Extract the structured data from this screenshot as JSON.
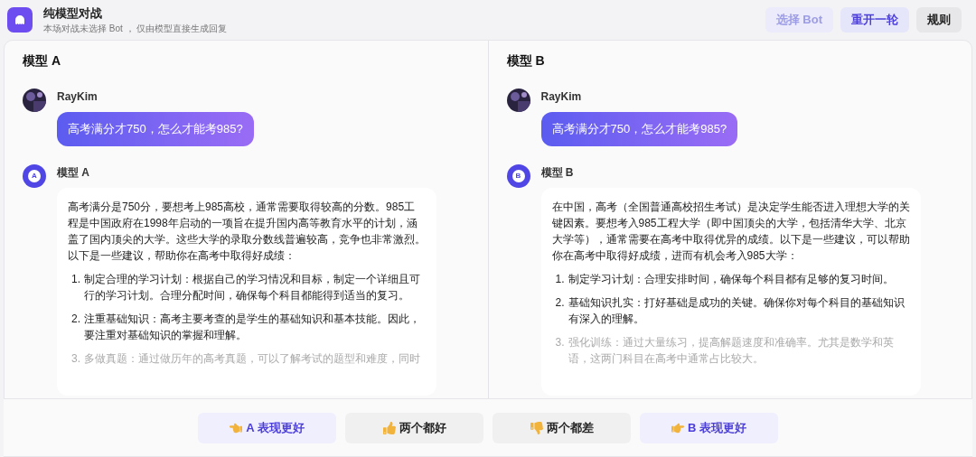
{
  "header": {
    "title": "纯模型对战",
    "subtitle": "本场对战未选择 Bot ， 仅由模型直接生成回复",
    "buttons": [
      {
        "label": "选择 Bot",
        "kind": "primary",
        "disabled": true
      },
      {
        "label": "重开一轮",
        "kind": "primary",
        "disabled": false
      },
      {
        "label": "规则",
        "kind": "neutral",
        "disabled": false
      }
    ]
  },
  "panels": [
    {
      "title": "模型 A",
      "user": {
        "name": "RayKim",
        "message": "高考满分才750，怎么才能考985?"
      },
      "bot": {
        "name": "模型 A",
        "avatar_label": "A",
        "intro": "高考满分是750分，要想考上985高校，通常需要取得较高的分数。985工程是中国政府在1998年启动的一项旨在提升国内高等教育水平的计划，涵盖了国内顶尖的大学。这些大学的录取分数线普遍较高，竞争也非常激烈。以下是一些建议，帮助你在高考中取得好成绩：",
        "items": [
          {
            "number": "1.",
            "text": "制定合理的学习计划：根据自己的学习情况和目标，制定一个详细且可行的学习计划。合理分配时间，确保每个科目都能得到适当的复习。",
            "faded": false
          },
          {
            "number": "2.",
            "text": "注重基础知识：高考主要考查的是学生的基础知识和基本技能。因此，要注重对基础知识的掌握和理解。",
            "faded": false
          },
          {
            "number": "3.",
            "text": "多做真题：通过做历年的高考真题，可以了解考试的题型和难度，同时",
            "faded": true
          }
        ]
      }
    },
    {
      "title": "模型 B",
      "user": {
        "name": "RayKim",
        "message": "高考满分才750，怎么才能考985?"
      },
      "bot": {
        "name": "模型 B",
        "avatar_label": "B",
        "intro": "在中国，高考（全国普通高校招生考试）是决定学生能否进入理想大学的关键因素。要想考入985工程大学（即中国顶尖的大学，包括清华大学、北京大学等），通常需要在高考中取得优异的成绩。以下是一些建议，可以帮助你在高考中取得好成绩，进而有机会考入985大学：",
        "items": [
          {
            "number": "1.",
            "text": "制定学习计划：合理安排时间，确保每个科目都有足够的复习时间。",
            "faded": false
          },
          {
            "number": "2.",
            "text": "基础知识扎实：打好基础是成功的关键。确保你对每个科目的基础知识有深入的理解。",
            "faded": false
          },
          {
            "number": "3.",
            "text": "强化训练：通过大量练习，提高解题速度和准确率。尤其是数学和英语，这两门科目在高考中通常占比较大。",
            "faded": true
          }
        ]
      }
    }
  ],
  "votes": [
    {
      "label": "A 表现更好",
      "kind": "left",
      "accent": true
    },
    {
      "label": "两个都好",
      "kind": "up",
      "accent": false
    },
    {
      "label": "两个都差",
      "kind": "down",
      "accent": false
    },
    {
      "label": "B 表现更好",
      "kind": "right",
      "accent": true
    }
  ]
}
